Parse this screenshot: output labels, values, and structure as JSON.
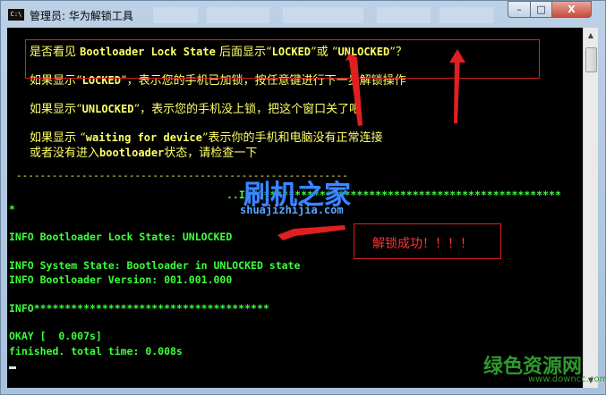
{
  "window": {
    "title": "管理员: 华为解锁工具",
    "app_icon": "console-icon",
    "app_icon_text": "C:\\",
    "controls": {
      "minimize": "–",
      "maximize": "□",
      "close": "X"
    }
  },
  "console": {
    "instructions": {
      "line1_prefix": "是否看见 ",
      "line1_code": "Bootloader Lock State",
      "line1_mid": " 后面显示“",
      "line1_code2": "LOCKED",
      "line1_mid2": "”或 “",
      "line1_code3": "UNLOCKED",
      "line1_end": "”？",
      "line2_prefix": "如果显示“",
      "line2_code": "LOCKED",
      "line2_end": "”，表示您的手机已加锁，按任意键进行下一步解锁操作",
      "line3_prefix": "如果显示“",
      "line3_code": "UNLOCKED",
      "line3_end": "”，表示您的手机没上锁，把这个窗口关了吧",
      "line4_prefix": "如果显示 “",
      "line4_code": "waiting for device",
      "line4_end": "”表示你的手机和电脑没有正常连接",
      "line5_prefix": "或者没有进入",
      "line5_code": "bootloader",
      "line5_end": "状态，请检查一下"
    },
    "separator": "--------------------------------------------------------",
    "log": {
      "info_star_line": "..INFO************************************************",
      "star": "*",
      "lock_state": "INFO Bootloader Lock State: UNLOCKED",
      "system_state": "INFO System State: Bootloader in UNLOCKED state",
      "bl_version": "INFO Bootloader Version: 001.001.000",
      "info_star_line2": "INFO**************************************",
      "okay": "OKAY [  0.007s]",
      "finished": "finished. total time: 0.008s"
    }
  },
  "annotation": {
    "success_text": "解锁成功！！！！"
  },
  "watermark": {
    "site_cn": "刷机之家",
    "site_url": "shuajizhijia.com"
  },
  "brand": {
    "name": "绿色资源网",
    "url": "www.downcc.com"
  },
  "colors": {
    "console_bg": "#000000",
    "instruction_text": "#ffff66",
    "log_text": "#3cff3c",
    "annotation_red": "#e02020"
  }
}
